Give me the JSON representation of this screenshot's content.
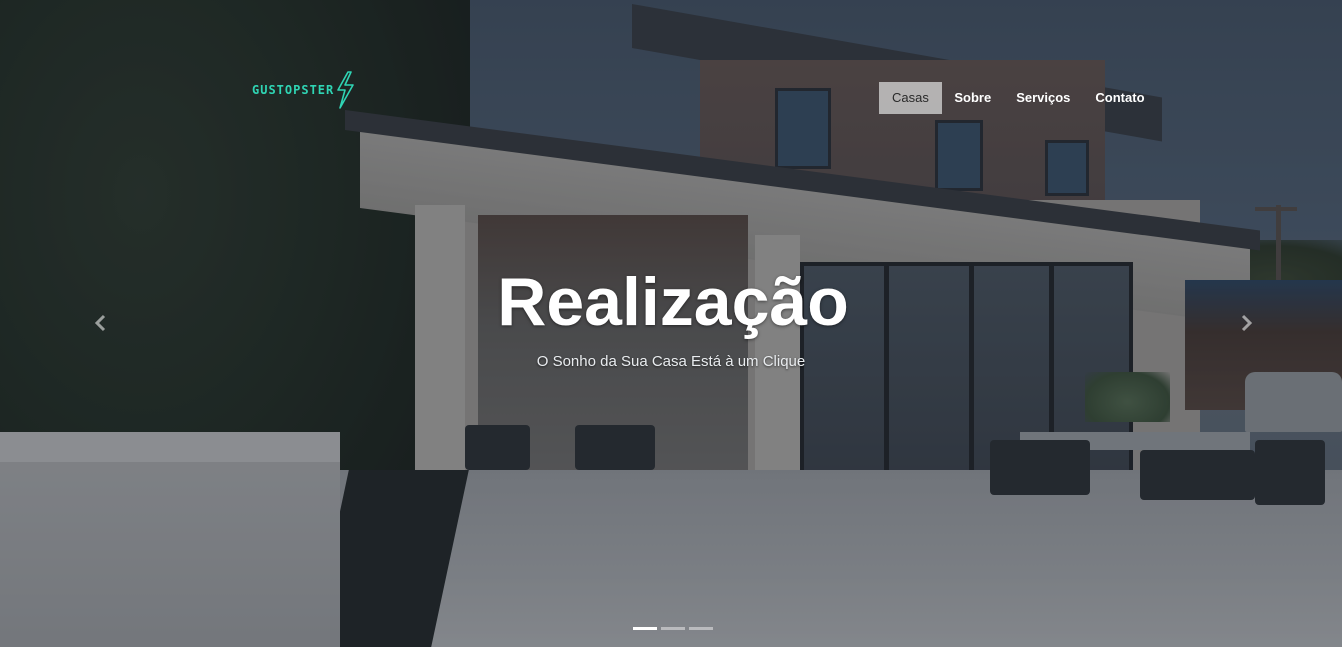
{
  "brand": {
    "logo_text": "GUSTOPSTER",
    "logo_color": "#2fd5b4"
  },
  "nav": {
    "items": [
      {
        "label": "Casas",
        "active": true
      },
      {
        "label": "Sobre",
        "active": false
      },
      {
        "label": "Serviços",
        "active": false
      },
      {
        "label": "Contato",
        "active": false
      }
    ]
  },
  "carousel": {
    "title": "Realização",
    "subtitle": "O Sonho da Sua Casa Está à um Clique",
    "prev_icon": "chevron-left-icon",
    "next_icon": "chevron-right-icon",
    "slide_count": 3,
    "active_index": 0
  }
}
